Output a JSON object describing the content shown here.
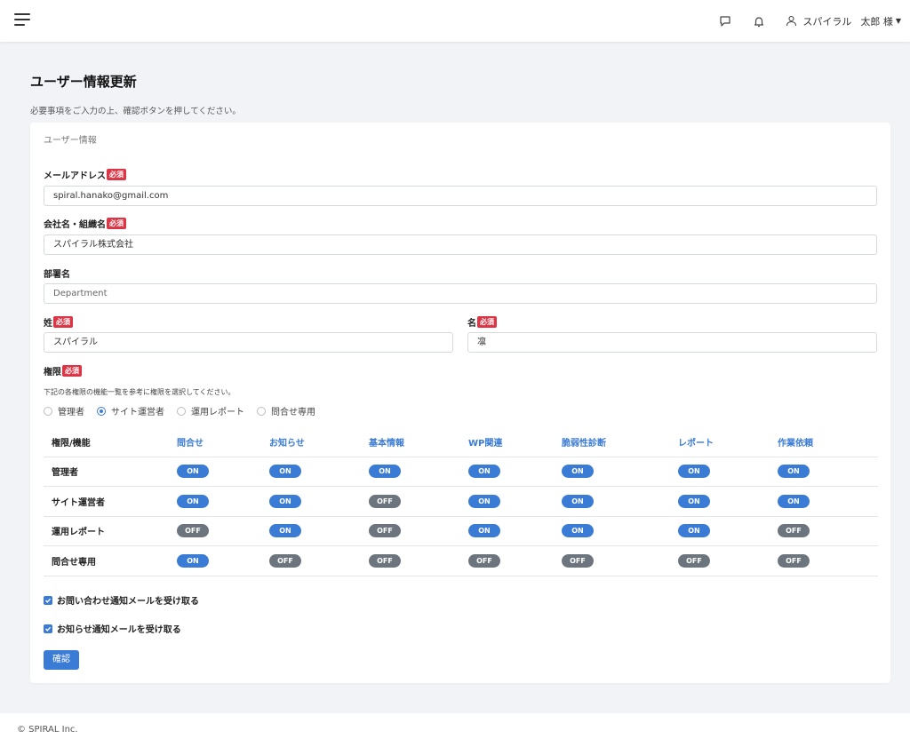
{
  "header": {
    "menu_icon": "hamburger-icon",
    "chat_icon": "chat-icon",
    "bell_icon": "bell-icon",
    "user_icon": "user-icon",
    "user_company": "スパイラル",
    "user_name": "太郎 様",
    "chevron_icon": "chevron-down-icon"
  },
  "page": {
    "title": "ユーザー情報更新",
    "subtitle": "必要事項をご入力の上、確認ボタンを押してください。"
  },
  "form": {
    "section_title": "ユーザー情報",
    "required_badge": "必須",
    "email": {
      "label": "メールアドレス",
      "value": "spiral.hanako@gmail.com"
    },
    "company": {
      "label": "会社名・組織名",
      "value": "スパイラル株式会社"
    },
    "department": {
      "label": "部署名",
      "placeholder": "Department"
    },
    "last_name": {
      "label": "姓",
      "value": "スパイラル"
    },
    "first_name": {
      "label": "名",
      "value": "凛"
    },
    "role": {
      "label": "権限",
      "hint": "下記の各権限の機能一覧を参考に権限を選択してください。",
      "options": [
        "管理者",
        "サイト運営者",
        "運用レポート",
        "問合せ専用"
      ],
      "selected": "サイト運営者"
    },
    "permissions": {
      "headers": [
        "権限/機能",
        "問合せ",
        "お知らせ",
        "基本情報",
        "WP関連",
        "脆弱性診断",
        "レポート",
        "作業依頼"
      ],
      "rows": [
        {
          "role": "管理者",
          "values": [
            "ON",
            "ON",
            "ON",
            "ON",
            "ON",
            "ON",
            "ON"
          ]
        },
        {
          "role": "サイト運営者",
          "values": [
            "ON",
            "ON",
            "OFF",
            "ON",
            "ON",
            "ON",
            "ON"
          ]
        },
        {
          "role": "運用レポート",
          "values": [
            "OFF",
            "ON",
            "OFF",
            "ON",
            "ON",
            "ON",
            "OFF"
          ]
        },
        {
          "role": "問合せ専用",
          "values": [
            "ON",
            "OFF",
            "OFF",
            "OFF",
            "OFF",
            "OFF",
            "OFF"
          ]
        }
      ]
    },
    "checkbox_inquiry": {
      "label": "お問い合わせ通知メールを受け取る",
      "checked": true
    },
    "checkbox_news": {
      "label": "お知らせ通知メールを受け取る",
      "checked": true
    },
    "submit_label": "確認"
  },
  "footer": {
    "copyright": "© SPIRAL Inc."
  },
  "colors": {
    "accent": "#3a7bd5",
    "required": "#dc3545",
    "off": "#6c757d",
    "background": "#f1f3f7"
  }
}
